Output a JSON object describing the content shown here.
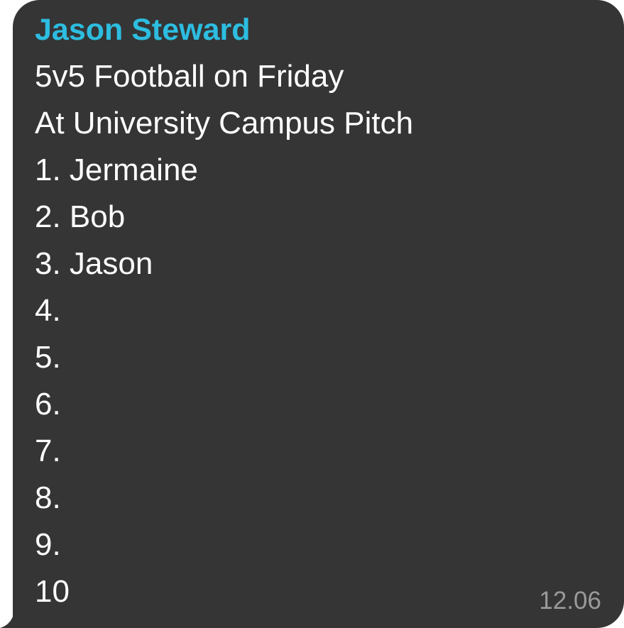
{
  "message": {
    "sender": "Jason Steward",
    "sender_color": "#2cbde0",
    "bubble_color": "#353535",
    "lines": [
      "5v5 Football on Friday",
      "At University Campus Pitch",
      "1. Jermaine",
      "2. Bob",
      "3. Jason",
      "4.",
      "5.",
      "6.",
      "7.",
      "8.",
      "9.",
      "10"
    ],
    "time": "12.06"
  }
}
